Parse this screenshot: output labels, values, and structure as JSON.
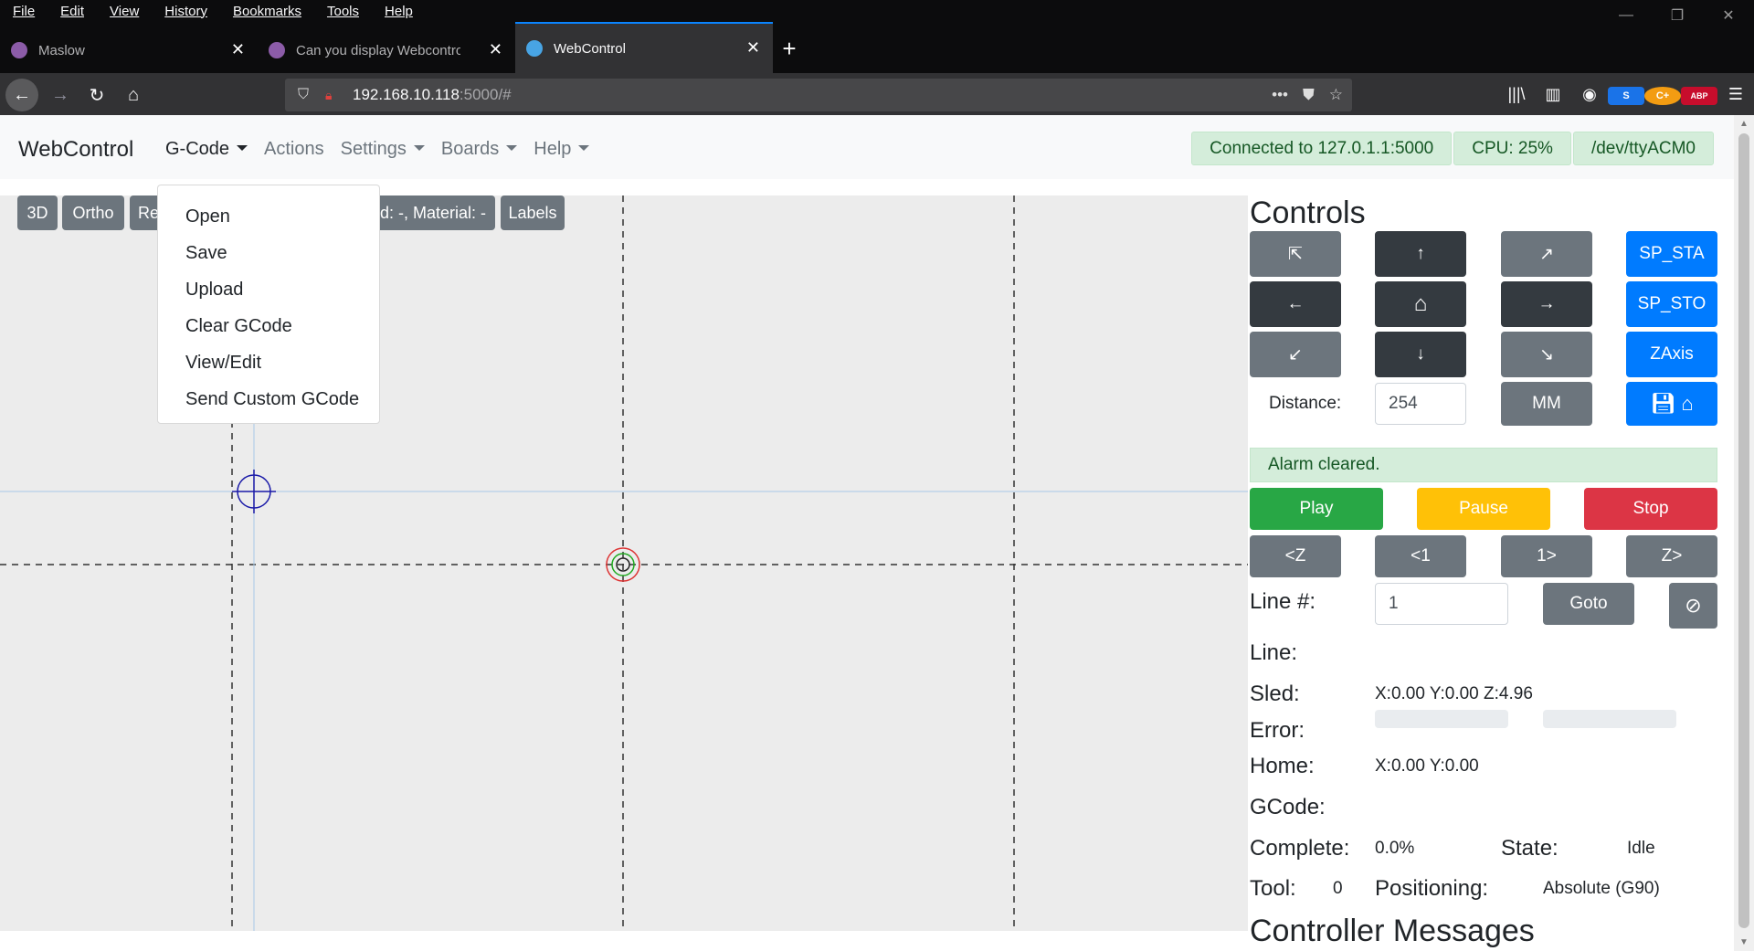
{
  "browser": {
    "menu": [
      "File",
      "Edit",
      "View",
      "History",
      "Bookmarks",
      "Tools",
      "Help"
    ],
    "tabs": [
      {
        "title": "Maslow",
        "active": false
      },
      {
        "title": "Can you display Webcontrol sc",
        "active": false
      },
      {
        "title": "WebControl",
        "active": true
      }
    ],
    "url_host": "192.168.10.118",
    "url_rest": ":5000/#",
    "ext_s": "S",
    "ext_c": "C+",
    "ext_abp": "ABP"
  },
  "nav": {
    "brand": "WebControl",
    "links": [
      "G-Code",
      "Actions",
      "Settings",
      "Boards",
      "Help"
    ],
    "connected": "Connected to 127.0.1.1:5000",
    "cpu": "CPU: 25%",
    "port": "/dev/ttyACM0"
  },
  "toolbar": {
    "btn_3d": "3D",
    "btn_ortho": "Ortho",
    "btn_reset": "Re",
    "board_info": "rd: -, Material: -",
    "btn_labels": "Labels"
  },
  "gcode_menu": [
    "Open",
    "Save",
    "Upload",
    "Clear GCode",
    "View/Edit",
    "Send Custom GCode"
  ],
  "controls": {
    "title": "Controls",
    "sp_sta": "SP_STA",
    "sp_sto": "SP_STO",
    "zaxis": "ZAxis",
    "distance_label": "Distance:",
    "distance_value": "254",
    "units": "MM",
    "alarm": "Alarm cleared.",
    "play": "Play",
    "pause": "Pause",
    "stop": "Stop",
    "z_back": "<Z",
    "line_back": "<1",
    "line_fwd": "1>",
    "z_fwd": "Z>",
    "line_num_label": "Line #:",
    "line_num_value": "1",
    "goto": "Goto",
    "line_label": "Line:",
    "sled_label": "Sled:",
    "sled_value": "X:0.00 Y:0.00 Z:4.96",
    "error_label": "Error:",
    "home_label": "Home:",
    "home_value": "X:0.00 Y:0.00",
    "gcode_label": "GCode:",
    "complete_label": "Complete:",
    "complete_value": "0.0%",
    "state_label": "State:",
    "state_value": "Idle",
    "tool_label": "Tool:",
    "tool_value": "0",
    "positioning_label": "Positioning:",
    "positioning_value": "Absolute (G90)",
    "messages_title": "Controller Messages"
  }
}
